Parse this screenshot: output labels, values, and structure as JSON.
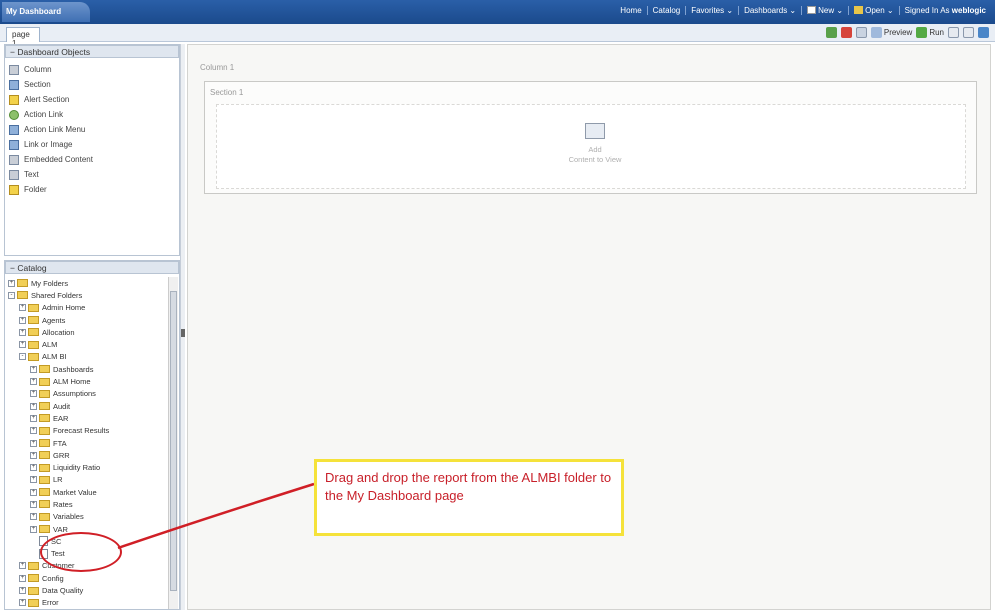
{
  "window": {
    "title": "My Dashboard"
  },
  "topnav": {
    "items": [
      "Home",
      "Catalog",
      "Favorites",
      "Dashboards",
      "New",
      "Open",
      "Signed In As"
    ],
    "user": "weblogic"
  },
  "tabs": {
    "page_tab": "page 1"
  },
  "toolbar": {
    "preview_label": "Preview",
    "run_label": "Run"
  },
  "objects_panel": {
    "title": "Dashboard Objects",
    "items": [
      {
        "label": "Column",
        "icon": "column-icon"
      },
      {
        "label": "Section",
        "icon": "section-icon"
      },
      {
        "label": "Alert Section",
        "icon": "alert-icon"
      },
      {
        "label": "Action Link",
        "icon": "action-link-icon"
      },
      {
        "label": "Action Link Menu",
        "icon": "action-link-menu-icon"
      },
      {
        "label": "Link or Image",
        "icon": "link-image-icon"
      },
      {
        "label": "Embedded Content",
        "icon": "embedded-content-icon"
      },
      {
        "label": "Text",
        "icon": "text-icon"
      },
      {
        "label": "Folder",
        "icon": "folder-icon"
      }
    ]
  },
  "catalog": {
    "title": "Catalog",
    "tree": [
      {
        "label": "My Folders",
        "indent": 0,
        "exp": "+",
        "type": "folder"
      },
      {
        "label": "Shared Folders",
        "indent": 0,
        "exp": "-",
        "type": "folder"
      },
      {
        "label": "Admin Home",
        "indent": 1,
        "exp": "+",
        "type": "folder"
      },
      {
        "label": "Agents",
        "indent": 1,
        "exp": "+",
        "type": "folder"
      },
      {
        "label": "Allocation",
        "indent": 1,
        "exp": "+",
        "type": "folder"
      },
      {
        "label": "ALM",
        "indent": 1,
        "exp": "+",
        "type": "folder"
      },
      {
        "label": "ALM BI",
        "indent": 1,
        "exp": "-",
        "type": "folder"
      },
      {
        "label": "Dashboards",
        "indent": 2,
        "exp": "+",
        "type": "folder"
      },
      {
        "label": "ALM Home",
        "indent": 2,
        "exp": "+",
        "type": "folder"
      },
      {
        "label": "Assumptions",
        "indent": 2,
        "exp": "+",
        "type": "folder"
      },
      {
        "label": "Audit",
        "indent": 2,
        "exp": "+",
        "type": "folder"
      },
      {
        "label": "EAR",
        "indent": 2,
        "exp": "+",
        "type": "folder"
      },
      {
        "label": "Forecast Results",
        "indent": 2,
        "exp": "+",
        "type": "folder"
      },
      {
        "label": "FTA",
        "indent": 2,
        "exp": "+",
        "type": "folder"
      },
      {
        "label": "GRR",
        "indent": 2,
        "exp": "+",
        "type": "folder"
      },
      {
        "label": "Liquidity Ratio",
        "indent": 2,
        "exp": "+",
        "type": "folder"
      },
      {
        "label": "LR",
        "indent": 2,
        "exp": "+",
        "type": "folder"
      },
      {
        "label": "Market Value",
        "indent": 2,
        "exp": "+",
        "type": "folder"
      },
      {
        "label": "Rates",
        "indent": 2,
        "exp": "+",
        "type": "folder"
      },
      {
        "label": "Variables",
        "indent": 2,
        "exp": "+",
        "type": "folder"
      },
      {
        "label": "VAR",
        "indent": 2,
        "exp": "+",
        "type": "folder"
      },
      {
        "label": "SC",
        "indent": 2,
        "exp": "",
        "type": "doc"
      },
      {
        "label": "Test",
        "indent": 2,
        "exp": "",
        "type": "doc"
      },
      {
        "label": "Customer",
        "indent": 1,
        "exp": "+",
        "type": "folder"
      },
      {
        "label": "Config",
        "indent": 1,
        "exp": "+",
        "type": "folder"
      },
      {
        "label": "Data Quality",
        "indent": 1,
        "exp": "+",
        "type": "folder"
      },
      {
        "label": "Error",
        "indent": 1,
        "exp": "+",
        "type": "folder"
      }
    ]
  },
  "canvas": {
    "column_label": "Column 1",
    "section_label": "Section 1",
    "drop_hint_1": "Add",
    "drop_hint_2": "Content to View"
  },
  "annotation": {
    "text": "Drag and drop the report from the ALMBI folder to the My Dashboard page",
    "border_color": "#f5e23a",
    "text_color": "#c8202a"
  }
}
